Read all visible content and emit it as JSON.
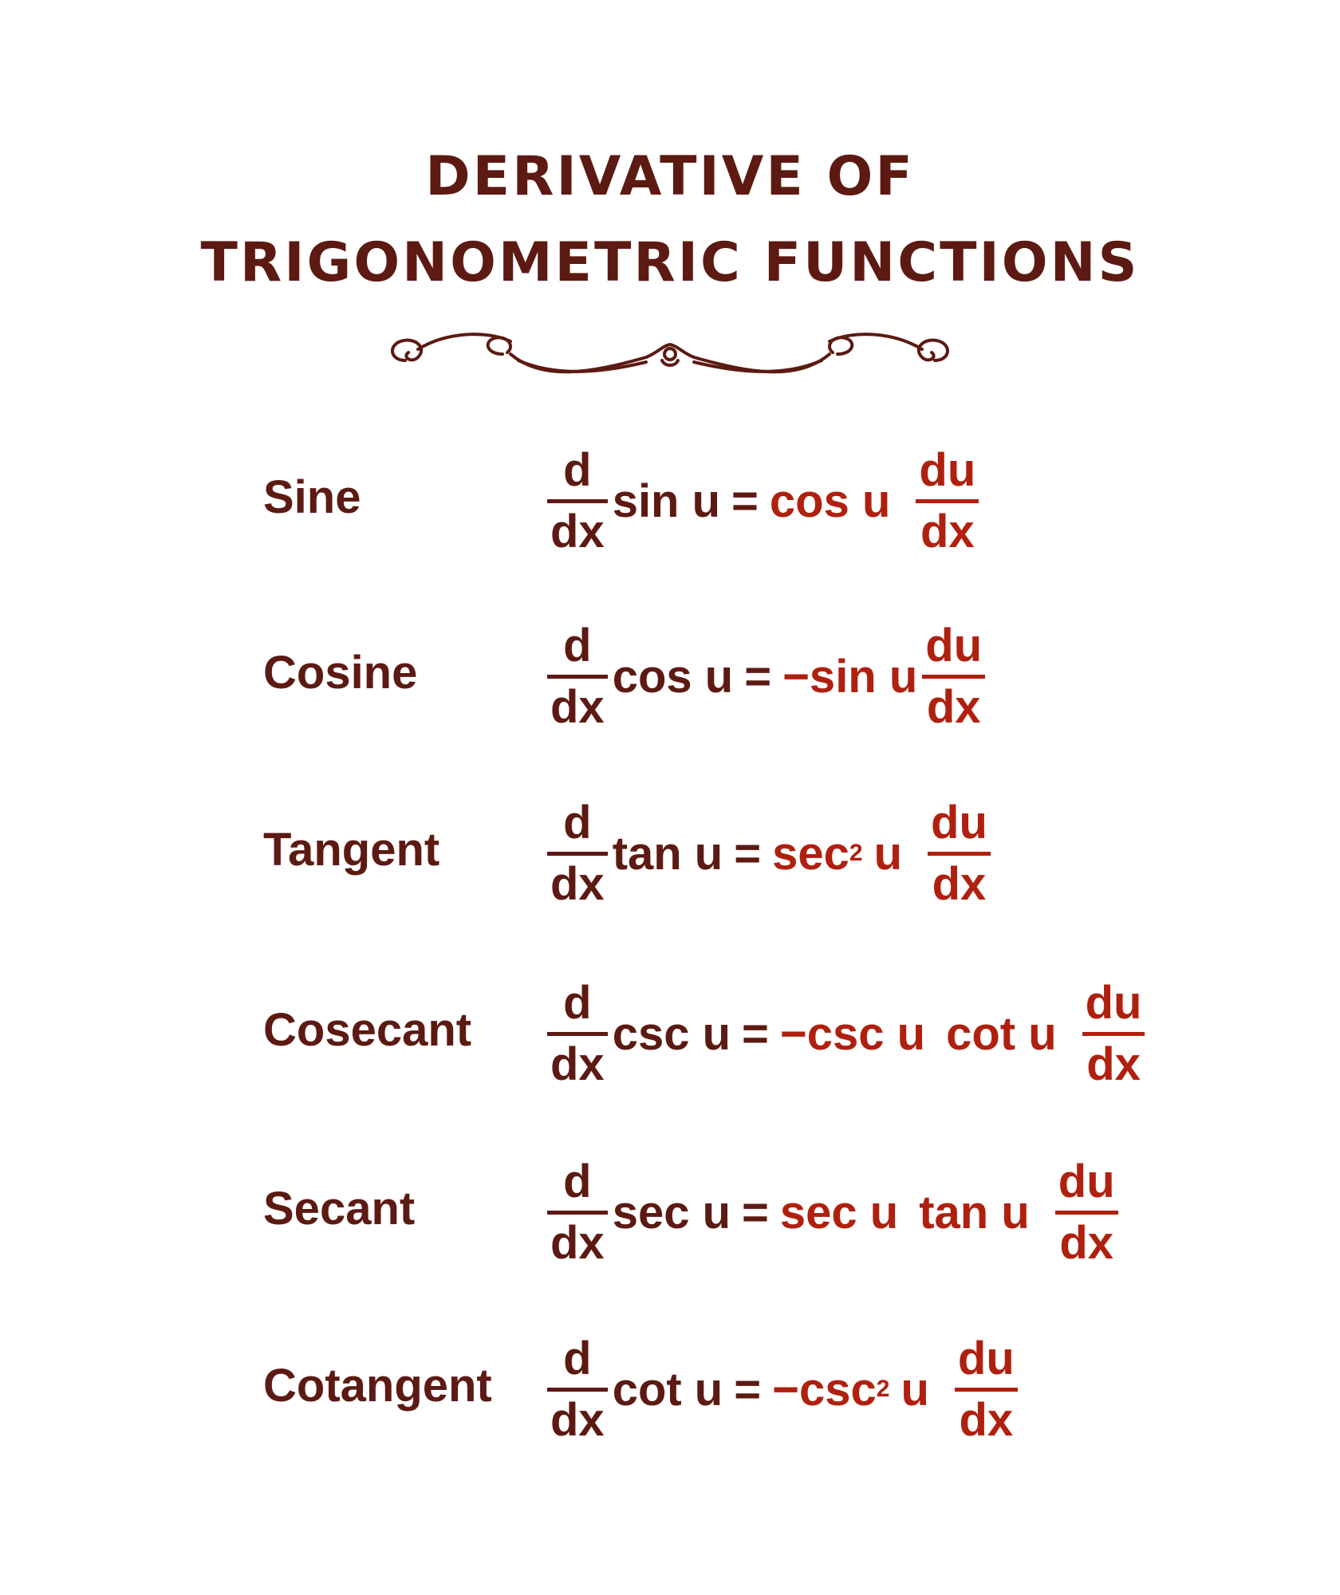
{
  "title": {
    "line1": "DERIVATIVE OF",
    "line2": "TRIGONOMETRIC FUNCTIONS"
  },
  "ornament": {
    "icon": "flourish-divider-icon",
    "color": "#5c1a12"
  },
  "colors": {
    "dark": "#5c1a12",
    "accent": "#b0200f"
  },
  "common": {
    "d": "d",
    "dx": "dx",
    "du": "du",
    "equals": "=",
    "u": "u",
    "power": "2"
  },
  "rows": [
    {
      "label": "Sine",
      "lhs": "sin u",
      "rhs_parts": [
        "cos u"
      ]
    },
    {
      "label": "Cosine",
      "lhs": "cos u",
      "rhs_parts": [
        "−sin u"
      ]
    },
    {
      "label": "Tangent",
      "lhs": "tan u",
      "rhs_parts": [
        "sec",
        "u"
      ]
    },
    {
      "label": "Cosecant",
      "lhs": "csc u",
      "rhs_parts": [
        "−csc u",
        "cot u"
      ]
    },
    {
      "label": "Secant",
      "lhs": "sec u",
      "rhs_parts": [
        "sec u",
        "tan u"
      ]
    },
    {
      "label": "Cotangent",
      "lhs": "cot u",
      "rhs_parts": [
        "−csc",
        "u"
      ]
    }
  ]
}
